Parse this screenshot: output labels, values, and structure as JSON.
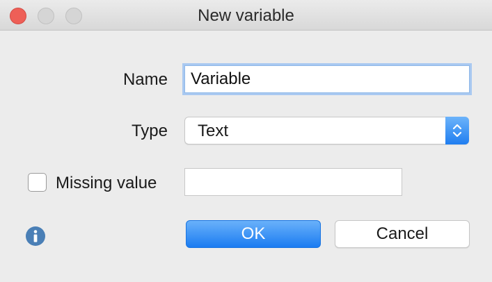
{
  "window": {
    "title": "New variable"
  },
  "form": {
    "name_label": "Name",
    "name_value": "Variable",
    "type_label": "Type",
    "type_selected": "Text",
    "missing_label": "Missing value",
    "missing_checked": false,
    "missing_value": ""
  },
  "buttons": {
    "ok_label": "OK",
    "cancel_label": "Cancel"
  },
  "icons": {
    "info": "info-icon",
    "stepper": "chevron-up-down-icon"
  },
  "colors": {
    "accent": "#1f7ef0",
    "close": "#ee5f57",
    "info": "#4a7fb6"
  }
}
